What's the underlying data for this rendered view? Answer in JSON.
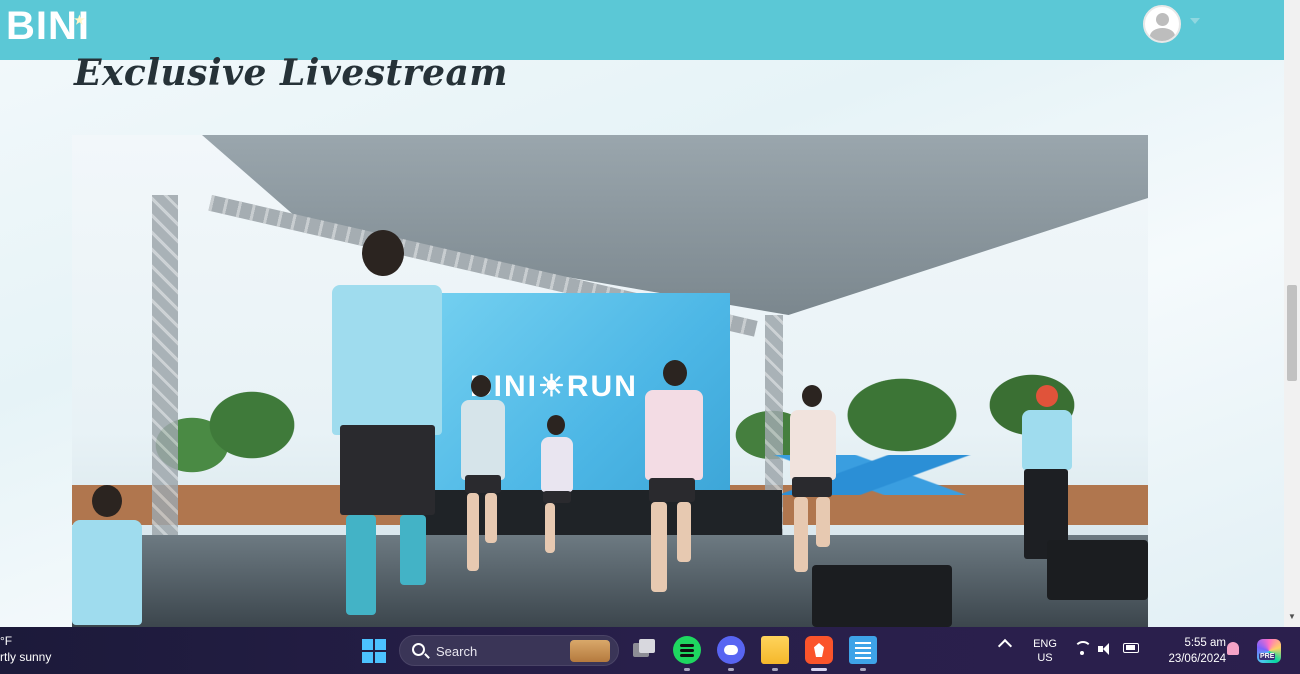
{
  "header": {
    "logo_text": "BINI",
    "brand_color": "#5bc8d6"
  },
  "main": {
    "title": "Exclusive Livestream",
    "video": {
      "screen_text": "BINI☀RUN"
    }
  },
  "taskbar": {
    "weather": {
      "temp": "°F",
      "condition": "rtly sunny"
    },
    "search_label": "Search",
    "language": [
      "ENG",
      "US"
    ],
    "time": "5:55 am",
    "date": "23/06/2024",
    "copilot_badge": "PRE",
    "icons": [
      "start-icon",
      "search-icon",
      "task-view-icon",
      "spotify-icon",
      "discord-icon",
      "file-explorer-icon",
      "brave-icon",
      "notepad-icon",
      "chevron-up-icon",
      "wifi-icon",
      "volume-icon",
      "battery-icon",
      "bell-icon",
      "copilot-icon"
    ]
  }
}
